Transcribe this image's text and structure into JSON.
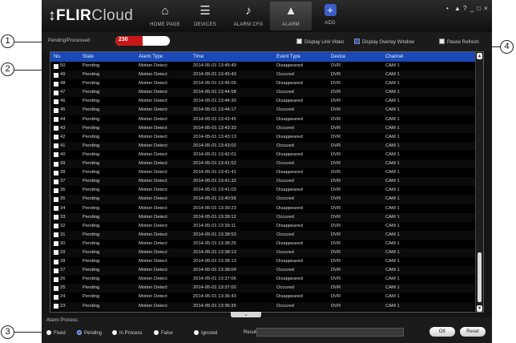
{
  "app": {
    "logo_brand": "FLIR",
    "logo_suffix": "Cloud",
    "nav": [
      {
        "label": "HOME PAGE",
        "icon": "home-icon"
      },
      {
        "label": "DEVICES",
        "icon": "devices-icon"
      },
      {
        "label": "ALARM CFG",
        "icon": "alarm-config-icon"
      },
      {
        "label": "ALARM",
        "icon": "alarm-icon"
      },
      {
        "label": "ADD",
        "icon": "add-icon"
      }
    ],
    "window_controls": [
      "•",
      "▲",
      "?",
      "_",
      "□",
      "×"
    ]
  },
  "toolbar": {
    "pending_label": "Pending/Processed",
    "pending_count": "230",
    "display_link_video": "Display Link Video",
    "display_overlay_window": "Display Overlay Window",
    "pause_refresh": "Pause Refresh"
  },
  "table": {
    "columns": [
      "No.",
      "State",
      "Alarm Type",
      "Time",
      "Event Type",
      "Device",
      "Channel"
    ],
    "rows": [
      [
        "50",
        "Pending",
        "Motion Detect",
        "2014-05-01 13:45:49",
        "Disappeared",
        "DVR",
        "CAM 1"
      ],
      [
        "49",
        "Pending",
        "Motion Detect",
        "2014-05-01 13:45:43",
        "Occured",
        "DVR",
        "CAM 1"
      ],
      [
        "48",
        "Pending",
        "Motion Detect",
        "2014-05-01 13:45:05",
        "Disappeared",
        "DVR",
        "CAM 1"
      ],
      [
        "47",
        "Pending",
        "Motion Detect",
        "2014-05-01 13:44:58",
        "Occured",
        "DVR",
        "CAM 1"
      ],
      [
        "46",
        "Pending",
        "Motion Detect",
        "2014-05-01 13:44:30",
        "Disappeared",
        "DVR",
        "CAM 1"
      ],
      [
        "45",
        "Pending",
        "Motion Detect",
        "2014-05-01 13:44:17",
        "Occured",
        "DVR",
        "CAM 1"
      ],
      [
        "44",
        "Pending",
        "Motion Detect",
        "2014-05-01 13:43:45",
        "Disappeared",
        "DVR",
        "CAM 1"
      ],
      [
        "43",
        "Pending",
        "Motion Detect",
        "2014-05-01 13:43:33",
        "Occured",
        "DVR",
        "CAM 1"
      ],
      [
        "42",
        "Pending",
        "Motion Detect",
        "2014-05-01 13:43:13",
        "Disappeared",
        "DVR",
        "CAM 1"
      ],
      [
        "41",
        "Pending",
        "Motion Detect",
        "2014-05-01 13:43:02",
        "Occured",
        "DVR",
        "CAM 1"
      ],
      [
        "40",
        "Pending",
        "Motion Detect",
        "2014-05-01 13:42:01",
        "Disappeared",
        "DVR",
        "CAM 1"
      ],
      [
        "39",
        "Pending",
        "Motion Detect",
        "2014-05-01 13:41:52",
        "Occured",
        "DVR",
        "CAM 1"
      ],
      [
        "38",
        "Pending",
        "Motion Detect",
        "2014-05-01 13:41:41",
        "Disappeared",
        "DVR",
        "CAM 1"
      ],
      [
        "37",
        "Pending",
        "Motion Detect",
        "2014-05-01 13:41:32",
        "Occured",
        "DVR",
        "CAM 1"
      ],
      [
        "36",
        "Pending",
        "Motion Detect",
        "2014-05-01 13:41:03",
        "Disappeared",
        "DVR",
        "CAM 1"
      ],
      [
        "35",
        "Pending",
        "Motion Detect",
        "2014-05-01 13:40:56",
        "Occured",
        "DVR",
        "CAM 1"
      ],
      [
        "34",
        "Pending",
        "Motion Detect",
        "2014-05-01 13:39:23",
        "Disappeared",
        "DVR",
        "CAM 1"
      ],
      [
        "33",
        "Pending",
        "Motion Detect",
        "2014-05-01 13:39:12",
        "Occured",
        "DVR",
        "CAM 1"
      ],
      [
        "32",
        "Pending",
        "Motion Detect",
        "2014-05-01 13:39:11",
        "Disappeared",
        "DVR",
        "CAM 1"
      ],
      [
        "31",
        "Pending",
        "Motion Detect",
        "2014-05-01 13:38:53",
        "Occured",
        "DVR",
        "CAM 1"
      ],
      [
        "30",
        "Pending",
        "Motion Detect",
        "2014-05-01 13:38:26",
        "Disappeared",
        "DVR",
        "CAM 1"
      ],
      [
        "29",
        "Pending",
        "Motion Detect",
        "2014-05-01 13:38:13",
        "Occured",
        "DVR",
        "CAM 1"
      ],
      [
        "28",
        "Pending",
        "Motion Detect",
        "2014-05-01 13:38:13",
        "Disappeared",
        "DVR",
        "CAM 1"
      ],
      [
        "27",
        "Pending",
        "Motion Detect",
        "2014-05-01 13:38:04",
        "Occured",
        "DVR",
        "CAM 1"
      ],
      [
        "26",
        "Pending",
        "Motion Detect",
        "2014-05-01 13:37:06",
        "Disappeared",
        "DVR",
        "CAM 1"
      ],
      [
        "25",
        "Pending",
        "Motion Detect",
        "2014-05-01 13:37:02",
        "Occured",
        "DVR",
        "CAM 1"
      ],
      [
        "24",
        "Pending",
        "Motion Detect",
        "2014-05-01 13:36:43",
        "Disappeared",
        "DVR",
        "CAM 1"
      ],
      [
        "23",
        "Pending",
        "Motion Detect",
        "2014-05-01 13:36:35",
        "Occured",
        "DVR",
        "CAM 1"
      ]
    ]
  },
  "alarm_process": {
    "label": "Alarm Process",
    "options": [
      "Fixed",
      "Pending",
      "In Process",
      "False",
      "Ignored"
    ],
    "selected": "Pending",
    "results_label": "Results:",
    "results_value": "",
    "ok_label": "OK",
    "reset_label": "Reset"
  },
  "callouts": [
    "1",
    "2",
    "3",
    "4"
  ],
  "colors": {
    "header_blue": "#1b49b5",
    "counter_red": "#c81818",
    "background": "#151515"
  }
}
